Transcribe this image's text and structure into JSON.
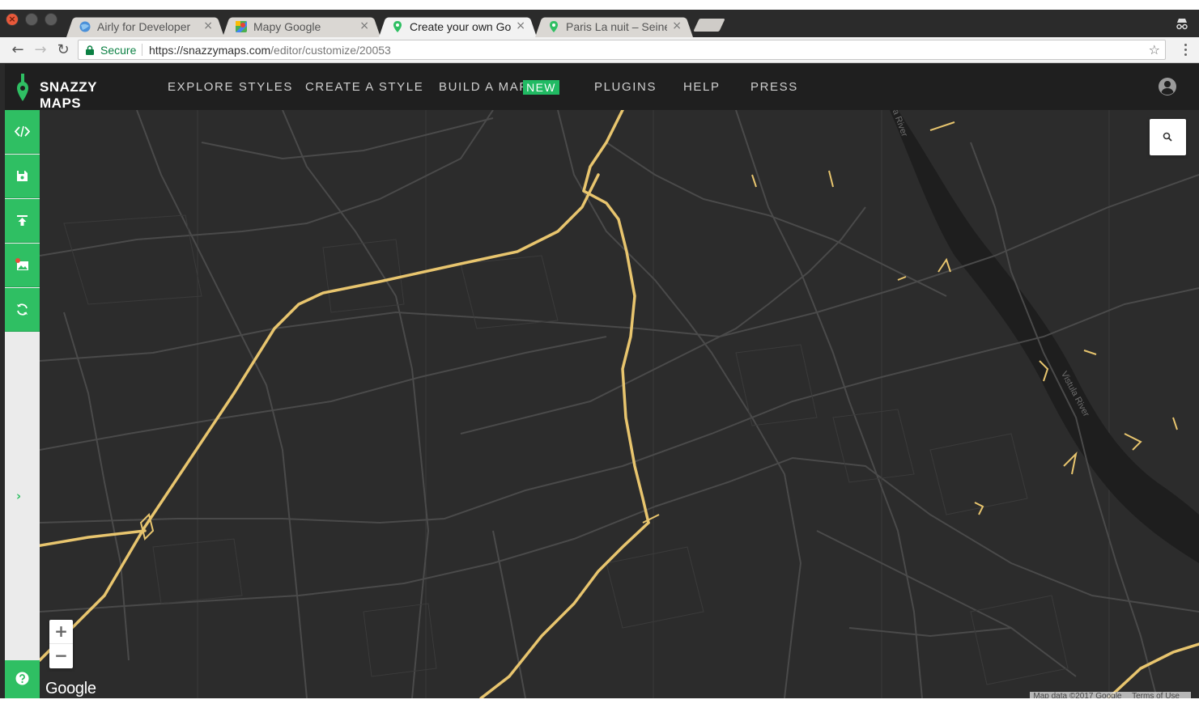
{
  "browser": {
    "tabs": [
      {
        "title": "Airly for Developer",
        "icon": "globe-icon",
        "active": false
      },
      {
        "title": "Mapy Google",
        "icon": "google-maps-icon",
        "active": false
      },
      {
        "title": "Create your own Go",
        "icon": "map-pin-icon",
        "active": true
      },
      {
        "title": "Paris La nuit – Seine",
        "icon": "map-pin-icon",
        "active": false
      }
    ],
    "close_glyph": "×",
    "secure_label": "Secure",
    "url_host": "https://snazzymaps.com",
    "url_path": "/editor/customize/20053"
  },
  "site": {
    "brand": "SNAZZY MAPS",
    "nav": [
      {
        "label": "EXPLORE STYLES"
      },
      {
        "label": "CREATE A STYLE"
      },
      {
        "label": "BUILD A MAP"
      },
      {
        "label": "PLUGINS"
      },
      {
        "label": "HELP"
      },
      {
        "label": "PRESS"
      }
    ],
    "new_badge": "NEW",
    "brand_color": "#2fbf63"
  },
  "map": {
    "google_logo": "Google",
    "zoom_in": "+",
    "zoom_out": "−",
    "attribution": [
      "Map data ©2017 Google",
      "Terms of Use"
    ],
    "river_label": "Vistula River",
    "road_color": "#555555",
    "highway_color": "#e8c56e",
    "background_color": "#2c2c2c"
  }
}
